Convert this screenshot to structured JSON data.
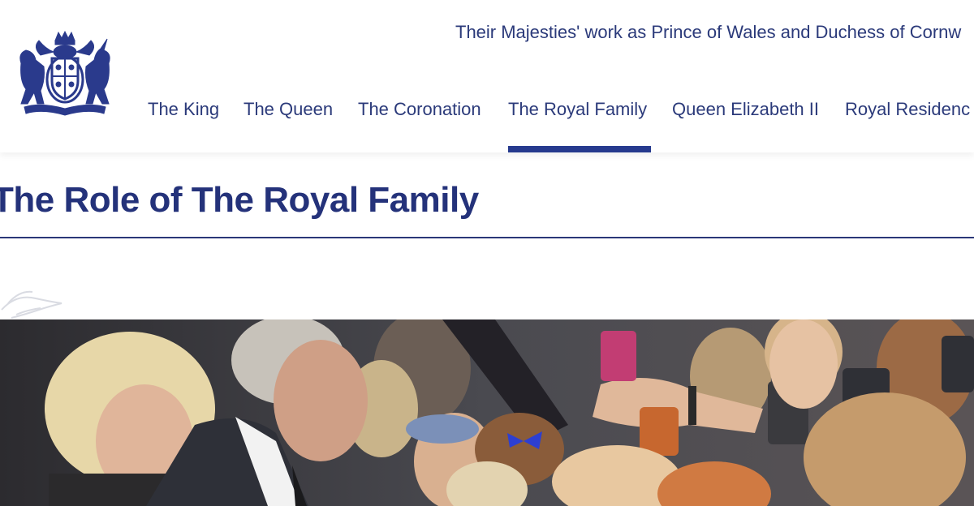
{
  "header": {
    "tagline": "Their Majesties' work as Prince of Wales and Duchess of Cornw",
    "logo_icon": "royal-coat-of-arms-icon",
    "nav": [
      {
        "label": "The King",
        "active": false
      },
      {
        "label": "The Queen",
        "active": false
      },
      {
        "label": "The Coronation",
        "active": false
      },
      {
        "label": "The Royal Family",
        "active": true
      },
      {
        "label": "Queen Elizabeth II",
        "active": false
      },
      {
        "label": "Royal Residenc",
        "active": false
      }
    ]
  },
  "main": {
    "title": "The Role of The Royal Family",
    "watermark_icon": "pegasus-watermark-icon",
    "hero_image": "royal-crowd-photo"
  },
  "colors": {
    "brand_navy": "#24327a",
    "nav_text": "#2b3a7a",
    "active_underline": "#263a8e",
    "background": "#ffffff"
  }
}
